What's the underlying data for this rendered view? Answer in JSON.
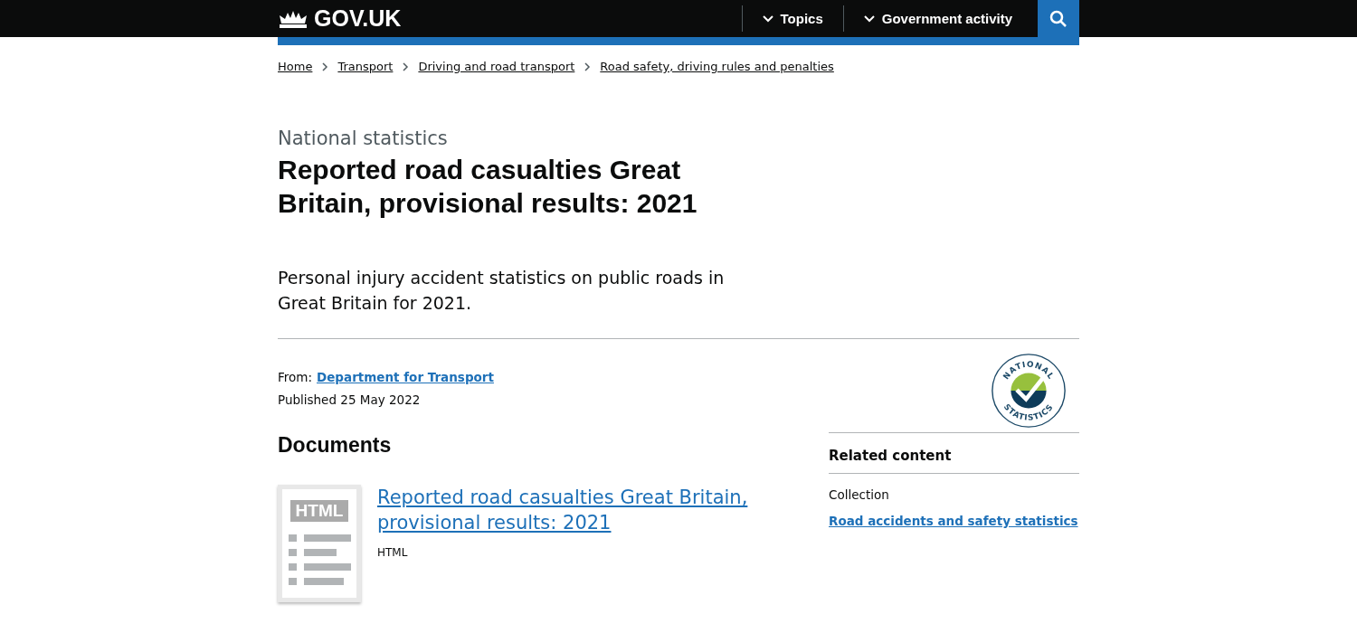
{
  "header": {
    "logo": "GOV.UK",
    "nav": [
      {
        "label": "Topics",
        "expanded": false
      },
      {
        "label": "Government activity",
        "expanded": false
      }
    ]
  },
  "breadcrumbs": [
    "Home",
    "Transport",
    "Driving and road transport",
    "Road safety, driving rules and penalties"
  ],
  "caption": "National statistics",
  "title": "Reported road casualties Great Britain, provisional results: 2021",
  "lead": "Personal injury accident statistics on public roads in Great Britain for 2021.",
  "metadata": {
    "from_label": "From:",
    "from_link": "Department for Transport",
    "published": "Published 25 May 2022"
  },
  "badge": {
    "top": "NATIONAL",
    "bottom": "STATISTICS"
  },
  "documents": {
    "heading": "Documents",
    "items": [
      {
        "thumb": "HTML",
        "title": "Reported road casualties Great Britain, provisional results: 2021",
        "format": "HTML"
      }
    ]
  },
  "related": {
    "heading": "Related content",
    "label": "Collection",
    "link": "Road accidents and safety statistics"
  }
}
